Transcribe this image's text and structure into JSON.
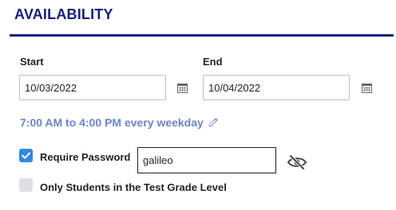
{
  "section": {
    "title": "AVAILABILITY"
  },
  "start": {
    "label": "Start",
    "value": "10/03/2022",
    "icon": "calendar-icon"
  },
  "end": {
    "label": "End",
    "value": "10/04/2022",
    "icon": "calendar-icon"
  },
  "schedule": {
    "text": "7:00 AM to 4:00 PM every weekday",
    "icon": "pencil-icon"
  },
  "require_password": {
    "label": "Require Password",
    "checked": true,
    "password_value": "galileo",
    "toggle_icon": "eye-slash-icon"
  },
  "grade_level": {
    "label": "Only Students in the Test Grade Level",
    "checked": false
  },
  "colors": {
    "title": "#14207a",
    "link": "#6b84c6",
    "checkbox_checked": "#2f8ad8",
    "checkbox_unchecked": "#dcdfe3"
  }
}
